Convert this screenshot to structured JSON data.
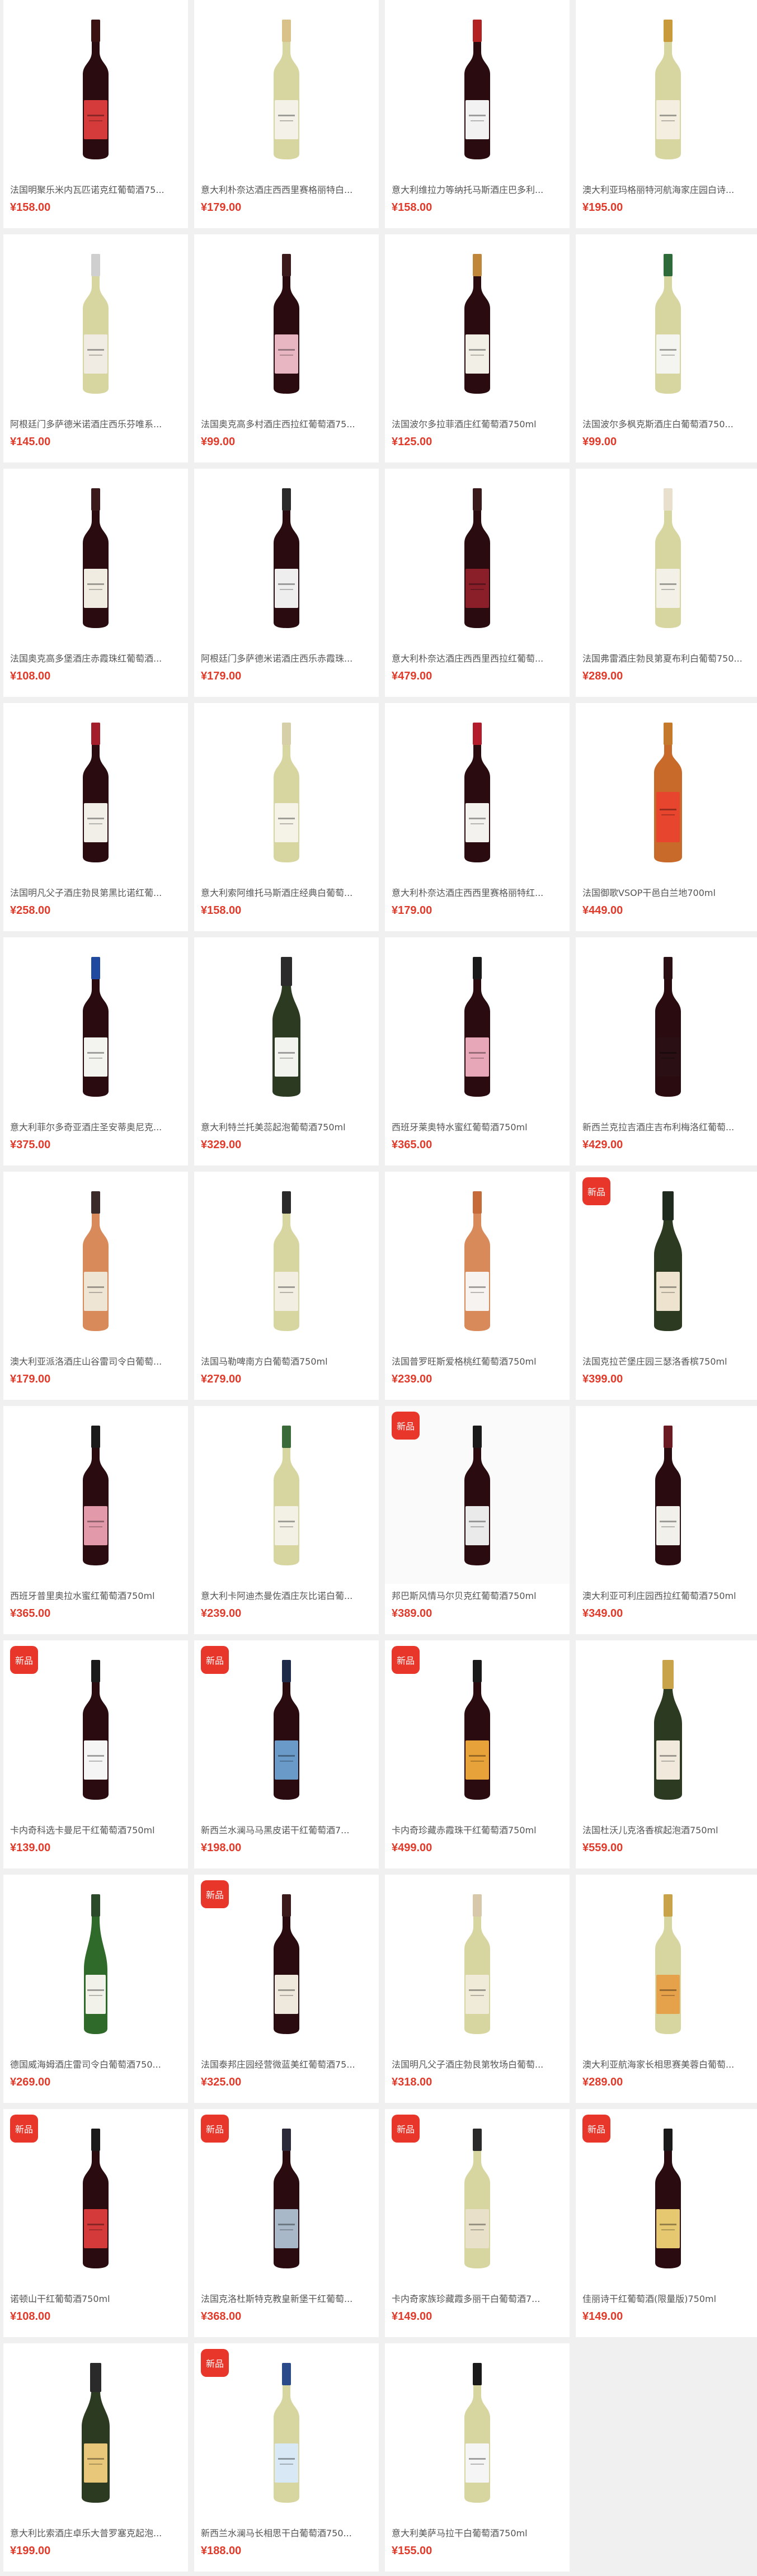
{
  "products": [
    {
      "title": "法国明聚乐米内瓦匹诺克红葡萄酒75...",
      "price": "¥158.00",
      "badge": "",
      "bottle": "red",
      "label": "#d63b3b",
      "cap": "#3a1212"
    },
    {
      "title": "意大利朴奈达酒庄西西里赛格丽特白...",
      "price": "¥179.00",
      "badge": "",
      "bottle": "white",
      "label": "#f4f1e8",
      "cap": "#d8c28a"
    },
    {
      "title": "意大利维拉力等纳托马斯酒庄巴多利...",
      "price": "¥158.00",
      "badge": "",
      "bottle": "red",
      "label": "#f2f2f2",
      "cap": "#b22222"
    },
    {
      "title": "澳大利亚玛格丽特河航海家庄园白诗...",
      "price": "¥195.00",
      "badge": "",
      "bottle": "white",
      "label": "#f3eee0",
      "cap": "#c89a3a"
    },
    {
      "title": "阿根廷门多萨德米诺酒庄西乐芬唯系...",
      "price": "¥145.00",
      "badge": "",
      "bottle": "white",
      "label": "#f0ece4",
      "cap": "#cfcfcf"
    },
    {
      "title": "法国奥克高多村酒庄西拉红葡萄酒75...",
      "price": "¥99.00",
      "badge": "",
      "bottle": "red",
      "label": "#e7b6c2",
      "cap": "#3a1a1a"
    },
    {
      "title": "法国波尔多拉菲酒庄红葡萄酒750ml",
      "price": "¥125.00",
      "badge": "",
      "bottle": "red",
      "label": "#f2efe6",
      "cap": "#c0863a"
    },
    {
      "title": "法国波尔多枫克斯酒庄白葡萄酒750...",
      "price": "¥99.00",
      "badge": "",
      "bottle": "white",
      "label": "#f4f4f0",
      "cap": "#2f6b3a"
    },
    {
      "title": "法国奥克高多堡酒庄赤霞珠红葡萄酒...",
      "price": "¥108.00",
      "badge": "",
      "bottle": "red",
      "label": "#f1ece2",
      "cap": "#3a1a1a"
    },
    {
      "title": "阿根廷门多萨德米诺酒庄西乐赤霞珠...",
      "price": "¥179.00",
      "badge": "",
      "bottle": "red",
      "label": "#eeeeee",
      "cap": "#2a2a2a"
    },
    {
      "title": "意大利朴奈达酒庄西西里西拉红葡萄...",
      "price": "¥479.00",
      "badge": "",
      "bottle": "red",
      "label": "#8a1f2a",
      "cap": "#3a1a1a"
    },
    {
      "title": "法国弗雷酒庄勃艮第夏布利白葡萄750...",
      "price": "¥289.00",
      "badge": "",
      "bottle": "white",
      "label": "#f3f0e8",
      "cap": "#e8e0cc"
    },
    {
      "title": "法国明凡父子酒庄勃艮第黑比诺红葡...",
      "price": "¥258.00",
      "badge": "",
      "bottle": "red",
      "label": "#f2efe8",
      "cap": "#a31e2a"
    },
    {
      "title": "意大利索阿维托马斯酒庄经典白葡萄...",
      "price": "¥158.00",
      "badge": "",
      "bottle": "white",
      "label": "#f5f3e8",
      "cap": "#d6cfa8"
    },
    {
      "title": "意大利朴奈达酒庄西西里赛格丽特红...",
      "price": "¥179.00",
      "badge": "",
      "bottle": "red",
      "label": "#f4f2ee",
      "cap": "#b31d2b"
    },
    {
      "title": "法国御歌VSOP干邑白兰地700ml",
      "price": "¥449.00",
      "badge": "",
      "bottle": "cognac",
      "label": "#e8452f",
      "cap": "#c47a2a"
    },
    {
      "title": "意大利菲尔多奇亚酒庄圣安蒂奥尼克...",
      "price": "¥375.00",
      "badge": "",
      "bottle": "red",
      "label": "#f3f3f0",
      "cap": "#1f4aa0"
    },
    {
      "title": "意大利特兰托美蕊起泡葡萄酒750ml",
      "price": "¥329.00",
      "badge": "",
      "bottle": "sparkling",
      "label": "#f2f2ee",
      "cap": "#2b2b2b"
    },
    {
      "title": "西班牙莱奥特水蜜红葡萄酒750ml",
      "price": "¥365.00",
      "badge": "",
      "bottle": "red",
      "label": "#e7a7b8",
      "cap": "#1a1a1a"
    },
    {
      "title": "新西兰克拉吉酒庄吉布利梅洛红葡萄...",
      "price": "¥429.00",
      "badge": "",
      "bottle": "red",
      "label": "#2a1014",
      "cap": "#2a1014"
    },
    {
      "title": "澳大利亚派洛酒庄山谷雷司令白葡萄...",
      "price": "¥179.00",
      "badge": "",
      "bottle": "rose",
      "label": "#efe5d4",
      "cap": "#3a2a2a"
    },
    {
      "title": "法国马勒啤南方白葡萄酒750ml",
      "price": "¥279.00",
      "badge": "",
      "bottle": "white",
      "label": "#f2eee2",
      "cap": "#2a2a2a"
    },
    {
      "title": "法国普罗旺斯爱格桃红葡萄酒750ml",
      "price": "¥239.00",
      "badge": "",
      "bottle": "rose",
      "label": "#f7f3f0",
      "cap": "#c66a3a"
    },
    {
      "title": "法国克拉芒堡庄园三瑟洛香槟750ml",
      "price": "¥399.00",
      "badge": "新品",
      "bottle": "sparkling",
      "label": "#ede3cf",
      "cap": "#1e2a1e"
    },
    {
      "title": "西班牙普里奥拉水蜜红葡萄酒750ml",
      "price": "¥365.00",
      "badge": "",
      "bottle": "red",
      "label": "#e29aab",
      "cap": "#1a1a1a"
    },
    {
      "title": "意大利卡阿迪杰曼佐酒庄灰比诺白葡...",
      "price": "¥239.00",
      "badge": "",
      "bottle": "white",
      "label": "#f3f1e6",
      "cap": "#3a6a3a"
    },
    {
      "title": "邦巴斯风情马尔贝克红葡萄酒750ml",
      "price": "¥389.00",
      "badge": "新品",
      "bottle": "red",
      "label": "#eaeaea",
      "cap": "#1a1a1a",
      "boxed": true
    },
    {
      "title": "澳大利亚可利庄园西拉红葡萄酒750ml",
      "price": "¥349.00",
      "badge": "",
      "bottle": "red",
      "label": "#f2f0ea",
      "cap": "#6a1a22"
    },
    {
      "title": "卡内奇科选卡曼尼干红葡萄酒750ml",
      "price": "¥139.00",
      "badge": "新品",
      "bottle": "red",
      "label": "#f5f5f5",
      "cap": "#1a1a1a"
    },
    {
      "title": "新西兰水澜马马黑皮诺干红葡萄酒7...",
      "price": "¥198.00",
      "badge": "新品",
      "bottle": "red",
      "label": "#6a9ac8",
      "cap": "#1e2a4a"
    },
    {
      "title": "卡内奇珍藏赤霞珠干红葡萄酒750ml",
      "price": "¥499.00",
      "badge": "新品",
      "bottle": "red",
      "label": "#e8a23a",
      "cap": "#1a1a1a"
    },
    {
      "title": "法国杜沃儿克洛香槟起泡酒750ml",
      "price": "¥559.00",
      "badge": "",
      "bottle": "sparkling",
      "label": "#f1eadc",
      "cap": "#c9a34a"
    },
    {
      "title": "德国威海姆酒庄雷司令白葡萄酒750...",
      "price": "¥269.00",
      "badge": "",
      "bottle": "rhine",
      "label": "#f3f2ea",
      "cap": "#2a4a2a"
    },
    {
      "title": "法国泰邦庄园经营微蓝美红葡萄酒75...",
      "price": "¥325.00",
      "badge": "新品",
      "bottle": "red",
      "label": "#efe8dc",
      "cap": "#3a1a1a"
    },
    {
      "title": "法国明凡父子酒庄勃艮第牧场白葡萄...",
      "price": "¥318.00",
      "badge": "",
      "bottle": "white",
      "label": "#f0ead8",
      "cap": "#d6c8a8"
    },
    {
      "title": "澳大利亚航海家长相思赛美蓉白葡萄...",
      "price": "¥289.00",
      "badge": "",
      "bottle": "white",
      "label": "#e6a24a",
      "cap": "#c9a34a"
    },
    {
      "title": "诺顿山干红葡萄酒750ml",
      "price": "¥108.00",
      "badge": "新品",
      "bottle": "red",
      "label": "#d43a3a",
      "cap": "#1a1a1a"
    },
    {
      "title": "法国克洛杜斯特克教皇新堡干红葡萄...",
      "price": "¥368.00",
      "badge": "新品",
      "bottle": "red",
      "label": "#a8b8c8",
      "cap": "#2a2a3a"
    },
    {
      "title": "卡内奇家族珍藏霞多丽干白葡萄酒7...",
      "price": "¥149.00",
      "badge": "新品",
      "bottle": "white",
      "label": "#e8e0c8",
      "cap": "#2a2a2a"
    },
    {
      "title": "佳丽诗干红葡萄酒(限量版)750ml",
      "price": "¥149.00",
      "badge": "新品",
      "bottle": "red",
      "label": "#e6c870",
      "cap": "#1a1a1a"
    },
    {
      "title": "意大利比索酒庄卓乐大普罗塞克起泡...",
      "price": "¥199.00",
      "badge": "",
      "bottle": "sparkling",
      "label": "#e8c77a",
      "cap": "#2a2a2a"
    },
    {
      "title": "新西兰水澜马长相思干白葡萄酒750...",
      "price": "¥188.00",
      "badge": "新品",
      "bottle": "white",
      "label": "#d8e8f4",
      "cap": "#2a4a8a"
    },
    {
      "title": "意大利美萨马拉干白葡萄酒750ml",
      "price": "¥155.00",
      "badge": "",
      "bottle": "white",
      "label": "#f5f5f5",
      "cap": "#1a1a1a"
    }
  ]
}
